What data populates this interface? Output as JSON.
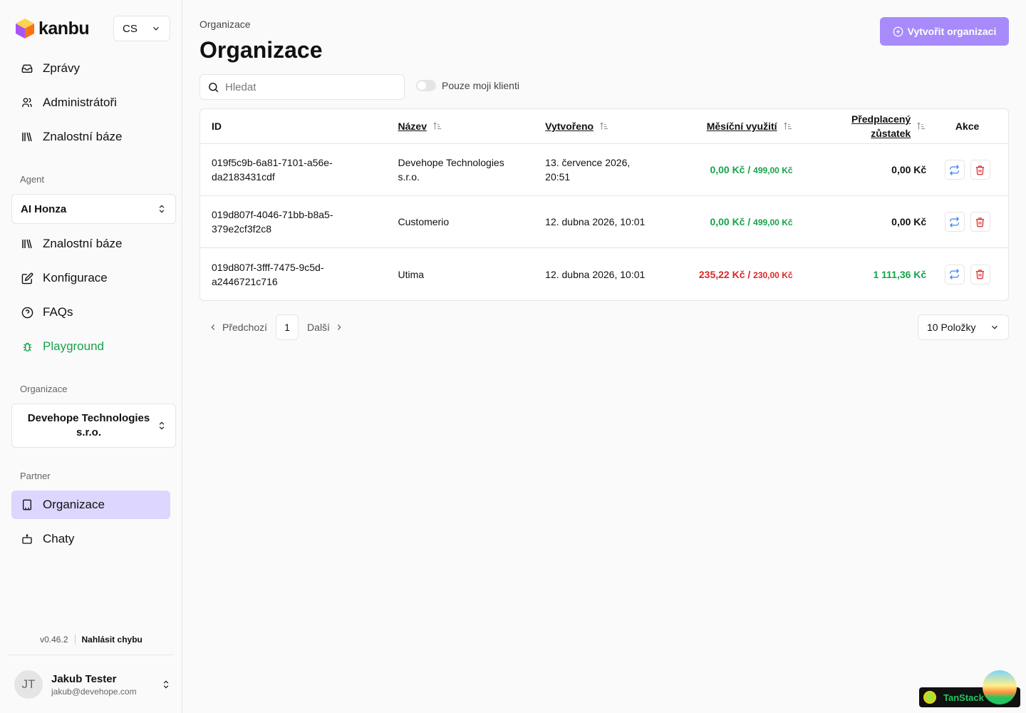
{
  "app": {
    "logo_text": "kanbu",
    "language": "CS"
  },
  "sidebar": {
    "top_items": [
      {
        "label": "Zprávy",
        "icon": "inbox-icon"
      },
      {
        "label": "Administrátoři",
        "icon": "users-icon"
      },
      {
        "label": "Znalostní báze",
        "icon": "library-icon"
      }
    ],
    "agent_label": "Agent",
    "agent_select": "AI Honza",
    "agent_items": [
      {
        "label": "Znalostní báze",
        "icon": "library-icon"
      },
      {
        "label": "Konfigurace",
        "icon": "edit-icon"
      },
      {
        "label": "FAQs",
        "icon": "help-circle-icon"
      },
      {
        "label": "Playground",
        "icon": "bug-icon"
      }
    ],
    "organization_label": "Organizace",
    "organization_select": "Devehope Technologies s.r.o.",
    "partner_label": "Partner",
    "partner_items": [
      {
        "label": "Organizace",
        "icon": "building-icon"
      },
      {
        "label": "Chaty",
        "icon": "bot-icon"
      }
    ],
    "version": "v0.46.2",
    "report_bug": "Nahlásit chybu",
    "user": {
      "initials": "JT",
      "name": "Jakub Tester",
      "email": "jakub@devehope.com"
    }
  },
  "main": {
    "breadcrumb": "Organizace",
    "title": "Organizace",
    "create_button": "Vytvořit organizaci",
    "search_placeholder": "Hledat",
    "toggle_label": "Pouze moji klienti",
    "columns": {
      "id": "ID",
      "name": "Název",
      "created": "Vytvořeno",
      "usage": "Měsíční využití",
      "balance_1": "Předplacený",
      "balance_2": "zůstatek",
      "actions": "Akce"
    },
    "rows": [
      {
        "id_1": "019f5c9b-6a81-7101-a56e-",
        "id_2": "da2183431cdf",
        "name_1": "Devehope Technologies",
        "name_2": "s.r.o.",
        "created_1": "13. července 2026,",
        "created_2": "20:51",
        "usage": "0,00 Kč",
        "limit": "499,00 Kč",
        "balance": "0,00 Kč"
      },
      {
        "id_1": "019d807f-4046-71bb-b8a5-",
        "id_2": "379e2cf3f2c8",
        "name_1": "Customerio",
        "name_2": "",
        "created_1": "12. dubna 2026, 10:01",
        "created_2": "",
        "usage": "0,00 Kč",
        "limit": "499,00 Kč",
        "balance": "0,00 Kč"
      },
      {
        "id_1": "019d807f-3fff-7475-9c5d-",
        "id_2": "a2446721c716",
        "name_1": "Utima",
        "name_2": "",
        "created_1": "12. dubna 2026, 10:01",
        "created_2": "",
        "usage": "235,22 Kč",
        "limit": "230,00 Kč",
        "balance": "1 111,36 Kč"
      }
    ],
    "pagination": {
      "prev": "Předchozí",
      "page": "1",
      "next": "Další",
      "per_page": "10 Položky"
    }
  },
  "devtools": {
    "label": "TanStack"
  },
  "colors": {
    "accent": "#a78bfa",
    "active_bg": "#ddd6fe",
    "green": "#16a34a",
    "red": "#dc2626"
  }
}
